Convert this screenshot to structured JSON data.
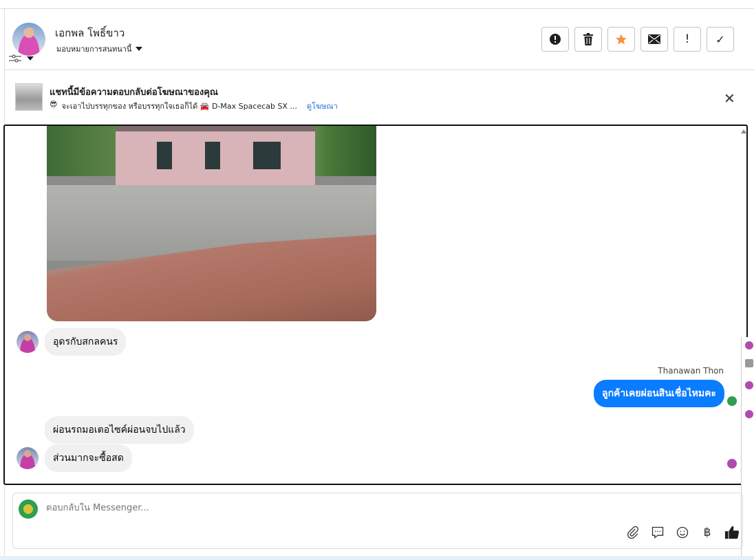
{
  "header": {
    "contact_name": "เอกพล โพธิ์ขาว",
    "assign_label": "มอบหมายการสนทนานี้",
    "actions": [
      {
        "name": "report-button",
        "icon": "alert-octagon-icon"
      },
      {
        "name": "delete-button",
        "icon": "trash-icon"
      },
      {
        "name": "star-button",
        "icon": "star-icon"
      },
      {
        "name": "mark-unread-button",
        "icon": "envelope-icon"
      },
      {
        "name": "priority-button",
        "icon": "exclamation-icon",
        "glyph": "!"
      },
      {
        "name": "mark-done-button",
        "icon": "check-icon",
        "glyph": "✓"
      }
    ],
    "star_color": "#f7923a"
  },
  "ad_banner": {
    "title": "แชทนี้มีข้อความตอบกลับต่อโฆษณาของคุณ",
    "emoji": "😎",
    "subtitle": "จะเอาไปบรรทุกของ หรือบรรทุกใจเธอก็ได้ 🚘 D-Max Spacecab SX ...",
    "link": "ดูโฆษณา"
  },
  "messages": [
    {
      "direction": "in",
      "text": "อุดรกับสกลคนร"
    },
    {
      "direction": "out",
      "sender": "Thanawan Thon",
      "text": "ลูกค้าเคยผ่อนสินเชื่อไหมคะ"
    },
    {
      "direction": "in",
      "text": "ผ่อนรถมอเตอไซค์ผ่อนจบไปแล้ว"
    },
    {
      "direction": "in",
      "text": "ส่วนมากจะซื้อสด"
    }
  ],
  "composer": {
    "placeholder": "ตอบกลับใน Messenger...",
    "baht_glyph": "฿"
  },
  "colors": {
    "accent": "#0a7cff",
    "link": "#216fdb"
  }
}
